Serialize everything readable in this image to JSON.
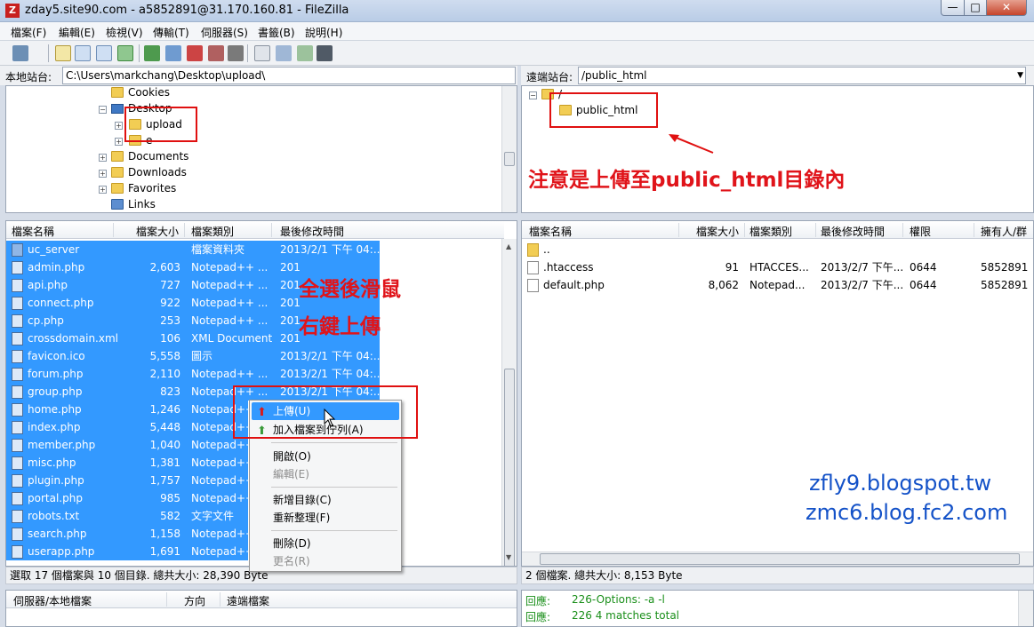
{
  "window": {
    "title": "zday5.site90.com - a5852891@31.170.160.81 - FileZilla",
    "app_icon": "Z"
  },
  "window_buttons": {
    "minimize": "—",
    "maximize": "□",
    "close": "✕"
  },
  "menu": [
    "檔案(F)",
    "編輯(E)",
    "檢視(V)",
    "傳輸(T)",
    "伺服器(S)",
    "書籤(B)",
    "說明(H)"
  ],
  "local": {
    "site_label": "本地站台:",
    "path": "C:\\Users\\markchang\\Desktop\\upload\\",
    "tree": [
      "Cookies",
      "Desktop",
      "upload",
      "e",
      "Documents",
      "Downloads",
      "Favorites",
      "Links"
    ],
    "columns": [
      "檔案名稱",
      "檔案大小",
      "檔案類別",
      "最後修改時間"
    ],
    "files": [
      {
        "name": "uc_server",
        "size": "",
        "type": "檔案資料夾",
        "date": "2013/2/1 下午 04:..."
      },
      {
        "name": "admin.php",
        "size": "2,603",
        "type": "Notepad++ ...",
        "date": "201"
      },
      {
        "name": "api.php",
        "size": "727",
        "type": "Notepad++ ...",
        "date": "201"
      },
      {
        "name": "connect.php",
        "size": "922",
        "type": "Notepad++ ...",
        "date": "201"
      },
      {
        "name": "cp.php",
        "size": "253",
        "type": "Notepad++ ...",
        "date": "201"
      },
      {
        "name": "crossdomain.xml",
        "size": "106",
        "type": "XML Document",
        "date": "201"
      },
      {
        "name": "favicon.ico",
        "size": "5,558",
        "type": "圖示",
        "date": "2013/2/1 下午 04:..."
      },
      {
        "name": "forum.php",
        "size": "2,110",
        "type": "Notepad++ ...",
        "date": "2013/2/1 下午 04:..."
      },
      {
        "name": "group.php",
        "size": "823",
        "type": "Notepad++ ...",
        "date": "2013/2/1 下午 04:..."
      },
      {
        "name": "home.php",
        "size": "1,246",
        "type": "Notepad++",
        "date": ""
      },
      {
        "name": "index.php",
        "size": "5,448",
        "type": "Notepad++",
        "date": ""
      },
      {
        "name": "member.php",
        "size": "1,040",
        "type": "Notepad++",
        "date": ""
      },
      {
        "name": "misc.php",
        "size": "1,381",
        "type": "Notepad++",
        "date": ""
      },
      {
        "name": "plugin.php",
        "size": "1,757",
        "type": "Notepad++",
        "date": ""
      },
      {
        "name": "portal.php",
        "size": "985",
        "type": "Notepad++",
        "date": ""
      },
      {
        "name": "robots.txt",
        "size": "582",
        "type": "文字文件",
        "date": ""
      },
      {
        "name": "search.php",
        "size": "1,158",
        "type": "Notepad++",
        "date": ""
      },
      {
        "name": "userapp.php",
        "size": "1,691",
        "type": "Notepad++",
        "date": ""
      }
    ],
    "status": "選取 17 個檔案與 10 個目錄. 總共大小: 28,390 Byte"
  },
  "remote": {
    "site_label": "遠端站台:",
    "path": "/public_html",
    "tree": [
      "/",
      "public_html"
    ],
    "columns": [
      "檔案名稱",
      "檔案大小",
      "檔案類別",
      "最後修改時間",
      "權限",
      "擁有人/群"
    ],
    "files": [
      {
        "name": "..",
        "size": "",
        "type": "",
        "date": "",
        "perm": "",
        "owner": ""
      },
      {
        "name": ".htaccess",
        "size": "91",
        "type": "HTACCES...",
        "date": "2013/2/7 下午...",
        "perm": "0644",
        "owner": "5852891"
      },
      {
        "name": "default.php",
        "size": "8,062",
        "type": "Notepad...",
        "date": "2013/2/7 下午...",
        "perm": "0644",
        "owner": "5852891"
      }
    ],
    "status": "2 個檔案. 總共大小: 8,153 Byte"
  },
  "context_menu": {
    "upload": "上傳(U)",
    "queue": "加入檔案到佇列(A)",
    "open": "開啟(O)",
    "edit": "編輯(E)",
    "mkdir": "新增目錄(C)",
    "refresh": "重新整理(F)",
    "delete": "刪除(D)",
    "rename": "更名(R)"
  },
  "queue": {
    "columns": [
      "伺服器/本地檔案",
      "方向",
      "遠端檔案"
    ]
  },
  "log": [
    {
      "label": "回應:",
      "text": "226-Options: -a -l"
    },
    {
      "label": "回應:",
      "text": "226 4 matches total"
    }
  ],
  "annotations": {
    "remote_note": "注意是上傳至public_html目錄內",
    "select_line1": "全選後滑鼠",
    "select_line2": "右鍵上傳",
    "blog1": "zfly9.blogspot.tw",
    "blog2": "zmc6.blog.fc2.com"
  },
  "colors": {
    "selection": "#3399ff",
    "annotation_red": "#e0141a",
    "blog_blue": "#1452c8",
    "log_green": "#1a8f1a"
  }
}
